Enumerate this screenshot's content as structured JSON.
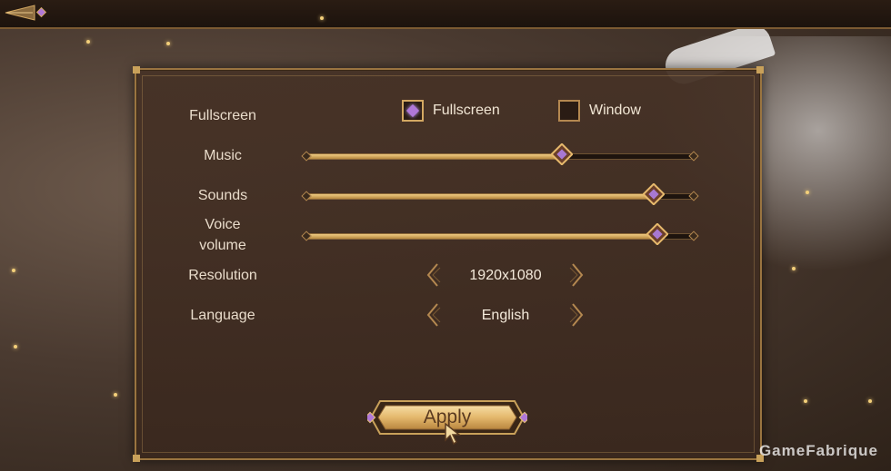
{
  "settings": {
    "fullscreen": {
      "label": "Fullscreen",
      "options": [
        "Fullscreen",
        "Window"
      ],
      "selected": "Fullscreen"
    },
    "music": {
      "label": "Music",
      "value": 0.66
    },
    "sounds": {
      "label": "Sounds",
      "value": 0.9
    },
    "voice": {
      "label_line1": "Voice",
      "label_line2": "volume",
      "value": 0.91
    },
    "resolution": {
      "label": "Resolution",
      "value": "1920x1080"
    },
    "language": {
      "label": "Language",
      "value": "English"
    }
  },
  "apply_label": "Apply",
  "watermark": "GameFabrique",
  "colors": {
    "accent_gold": "#d3a862",
    "accent_purple": "#b078d8",
    "panel": "#463226"
  }
}
